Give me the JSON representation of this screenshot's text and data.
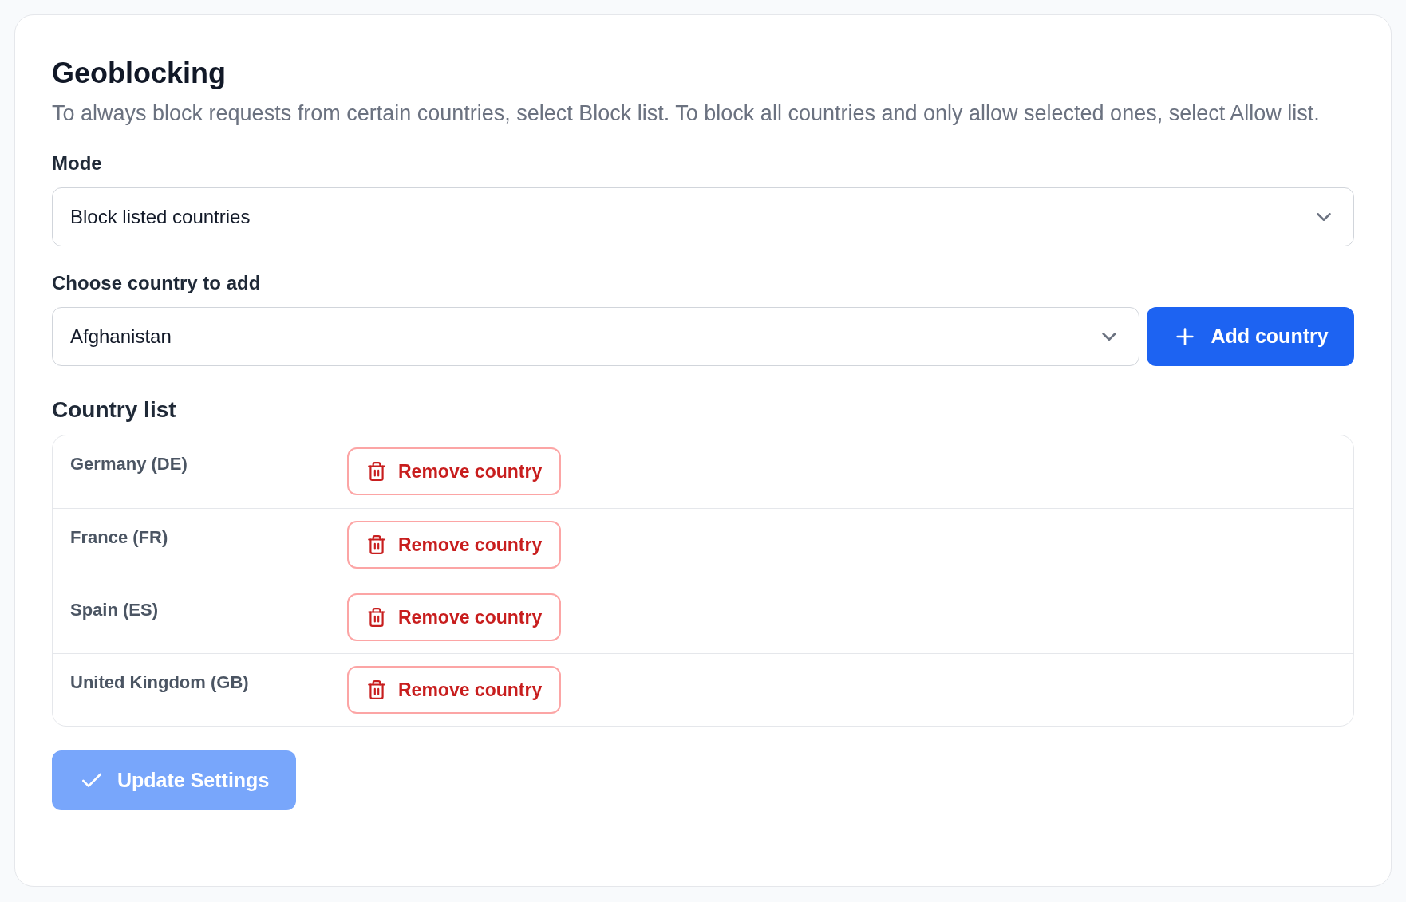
{
  "title": "Geoblocking",
  "description": "To always block requests from certain countries, select Block list. To block all countries and only allow selected ones, select Allow list.",
  "mode": {
    "label": "Mode",
    "value": "Block listed countries"
  },
  "country_picker": {
    "label": "Choose country to add",
    "value": "Afghanistan",
    "button": "Add country"
  },
  "country_list": {
    "label": "Country list",
    "rows": [
      {
        "name": "Germany (DE)",
        "button": "Remove country"
      },
      {
        "name": "France (FR)",
        "button": "Remove country"
      },
      {
        "name": "Spain (ES)",
        "button": "Remove country"
      },
      {
        "name": "United Kingdom (GB)",
        "button": "Remove country"
      }
    ]
  },
  "submit": {
    "label": "Update Settings",
    "disabled": true
  }
}
